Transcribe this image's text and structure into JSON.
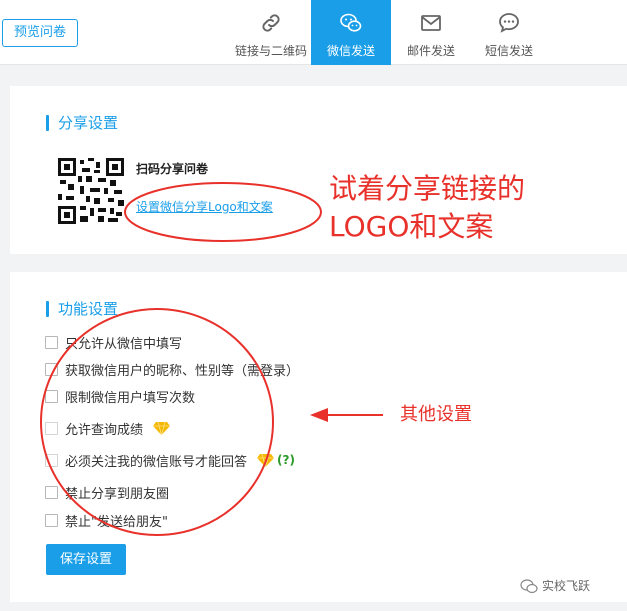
{
  "header": {
    "preview_button": "预览问卷",
    "tabs": [
      {
        "label": "链接与二维码",
        "icon": "link-icon",
        "active": false
      },
      {
        "label": "微信发送",
        "icon": "wechat-icon",
        "active": true
      },
      {
        "label": "邮件发送",
        "icon": "mail-icon",
        "active": false
      },
      {
        "label": "短信发送",
        "icon": "sms-icon",
        "active": false
      }
    ]
  },
  "share_settings": {
    "title": "分享设置",
    "qr_caption": "扫码分享问卷",
    "link_text": "设置微信分享Logo和文案"
  },
  "function_settings": {
    "title": "功能设置",
    "options": [
      {
        "label": "只允许从微信中填写",
        "checked": false
      },
      {
        "label": "获取微信用户的昵称、性别等（需登录）",
        "checked": false
      },
      {
        "label": "限制微信用户填写次数",
        "checked": false
      },
      {
        "label": "允许查询成绩",
        "checked": false,
        "badge": "gem-icon"
      },
      {
        "label": "必须关注我的微信账号才能回答",
        "checked": false,
        "badge": "gem-icon",
        "help": "(?)"
      },
      {
        "label": "禁止分享到朋友圈",
        "checked": false
      },
      {
        "label": "禁止\"发送给朋友\"",
        "checked": false
      }
    ],
    "save_button": "保存设置"
  },
  "annotations": {
    "share_note_line1": "试着分享链接的",
    "share_note_line2": "LOGO和文案",
    "other_note": "其他设置",
    "color": "#e8312a"
  },
  "watermark": {
    "text": "实校飞跃"
  },
  "colors": {
    "accent": "#1a9ee8",
    "background": "#f2f3f5"
  }
}
